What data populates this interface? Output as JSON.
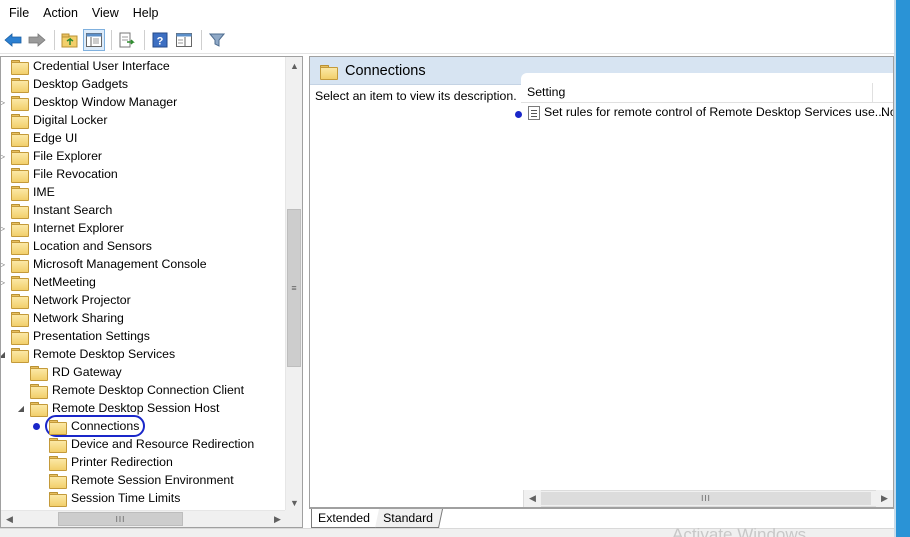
{
  "menu": [
    "File",
    "Action",
    "View",
    "Help"
  ],
  "toolbar": {
    "icons": [
      "back-arrow-icon",
      "forward-arrow-icon",
      "up-folder-icon",
      "show-hide-tree-icon",
      "export-list-icon",
      "help-icon",
      "properties-icon",
      "filter-icon"
    ]
  },
  "tree": {
    "items": [
      {
        "label": "Credential User Interface",
        "level": 0,
        "expander": ""
      },
      {
        "label": "Desktop Gadgets",
        "level": 0,
        "expander": ""
      },
      {
        "label": "Desktop Window Manager",
        "level": 0,
        "expander": "▷"
      },
      {
        "label": "Digital Locker",
        "level": 0,
        "expander": ""
      },
      {
        "label": "Edge UI",
        "level": 0,
        "expander": ""
      },
      {
        "label": "File Explorer",
        "level": 0,
        "expander": "▷"
      },
      {
        "label": "File Revocation",
        "level": 0,
        "expander": ""
      },
      {
        "label": "IME",
        "level": 0,
        "expander": ""
      },
      {
        "label": "Instant Search",
        "level": 0,
        "expander": ""
      },
      {
        "label": "Internet Explorer",
        "level": 0,
        "expander": "▷"
      },
      {
        "label": "Location and Sensors",
        "level": 0,
        "expander": ""
      },
      {
        "label": "Microsoft Management Console",
        "level": 0,
        "expander": "▷"
      },
      {
        "label": "NetMeeting",
        "level": 0,
        "expander": "▷"
      },
      {
        "label": "Network Projector",
        "level": 0,
        "expander": ""
      },
      {
        "label": "Network Sharing",
        "level": 0,
        "expander": ""
      },
      {
        "label": "Presentation Settings",
        "level": 0,
        "expander": ""
      },
      {
        "label": "Remote Desktop Services",
        "level": 0,
        "expander": "◢"
      },
      {
        "label": "RD Gateway",
        "level": 1,
        "expander": ""
      },
      {
        "label": "Remote Desktop Connection Client",
        "level": 1,
        "expander": ""
      },
      {
        "label": "Remote Desktop Session Host",
        "level": 1,
        "expander": "◢"
      },
      {
        "label": "Connections",
        "level": 2,
        "expander": "",
        "selected": true
      },
      {
        "label": "Device and Resource Redirection",
        "level": 2,
        "expander": ""
      },
      {
        "label": "Printer Redirection",
        "level": 2,
        "expander": ""
      },
      {
        "label": "Remote Session Environment",
        "level": 2,
        "expander": ""
      },
      {
        "label": "Session Time Limits",
        "level": 2,
        "expander": ""
      }
    ]
  },
  "right": {
    "title": "Connections",
    "description": "Select an item to view its description.",
    "columns": {
      "setting": "Setting",
      "state": ""
    },
    "rows": [
      {
        "setting": "Set rules for remote control of Remote Desktop Services use...",
        "state": "No"
      }
    ]
  },
  "tabs": [
    "Extended",
    "Standard"
  ],
  "watermark": "Activate Windows",
  "colors": {
    "annotation": "#1a27c9",
    "header": "#d7e4f2",
    "window_edge": "#2a93d6"
  }
}
